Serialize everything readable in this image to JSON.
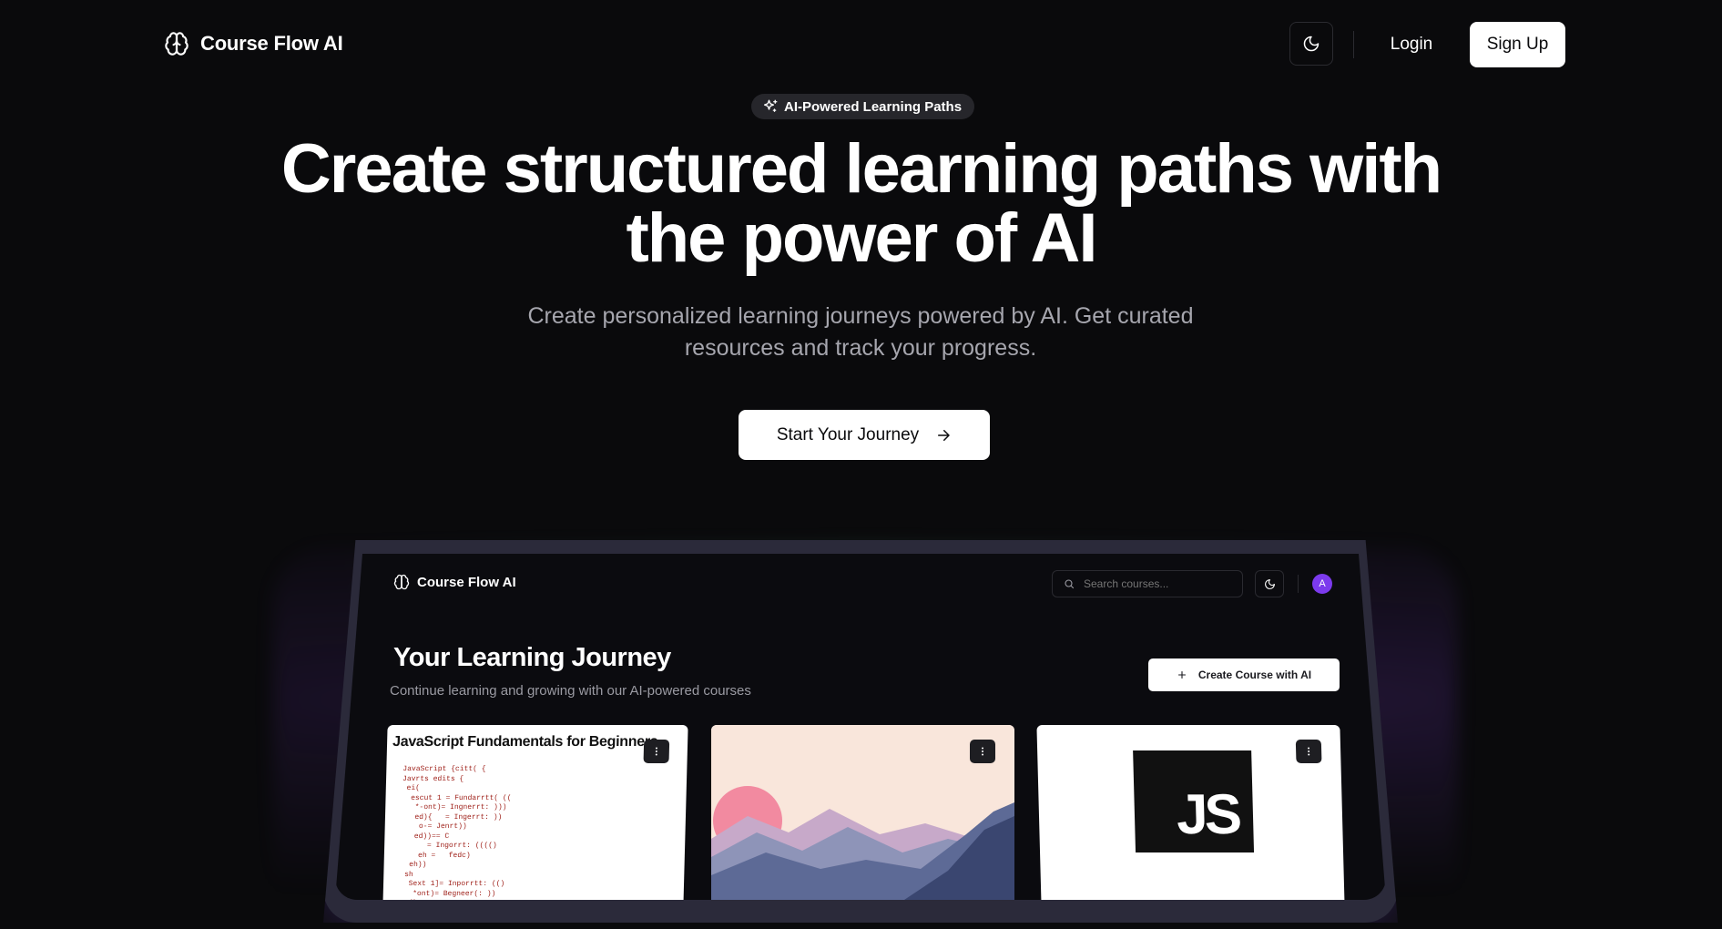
{
  "nav": {
    "brand": "Course Flow AI",
    "login": "Login",
    "signup": "Sign Up"
  },
  "hero": {
    "badge": "AI-Powered Learning Paths",
    "title_line1": "Create structured learning paths with",
    "title_line2": "the power of AI",
    "subtitle_line1": "Create personalized learning journeys powered by AI. Get curated",
    "subtitle_line2": "resources and track your progress.",
    "cta": "Start Your Journey"
  },
  "preview": {
    "brand": "Course Flow AI",
    "search_placeholder": "Search courses...",
    "avatar_letter": "A",
    "title": "Your Learning Journey",
    "subtitle": "Continue learning and growing with our AI-powered courses",
    "create_button": "Create Course with AI",
    "cards": [
      {
        "title": "JavaScript Fundamentals for Beginners",
        "code": "JavaScript {citt( {\nJavrts edits {\n ei(\n  escut 1 = Fundarrtt( ((\n   *-ont)= Ingnerrt: )))\n   ed){   = Ingerrt: ))\n    o-= Jenrt))\n   ed))== C\n      = Ingorrt: (((()\n    eh =   fedc)\n  eh))\n sh\n  Sext 1]= Inporrtt: (()\n   *ont)= Begneer(: ))\n ed)"
      },
      {
        "title": ""
      },
      {
        "logo_text": "JS"
      }
    ]
  },
  "colors": {
    "background": "#0a0a0c",
    "badge_bg": "#26262b",
    "avatar": "#7c3aed"
  }
}
